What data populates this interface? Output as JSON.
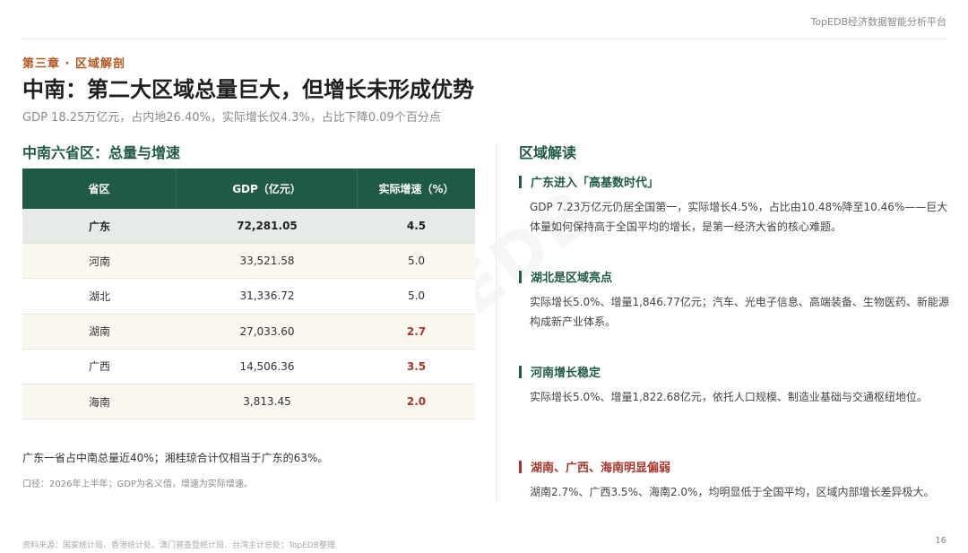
{
  "header": {
    "brand": "TopEDB经济数据智能分析平台"
  },
  "chapter": "第三章 · 区域解剖",
  "title": "中南：第二大区域总量巨大，但增长未形成优势",
  "subtitle": "GDP 18.25万亿元，占内地26.40%，实际增长仅4.3%，占比下降0.09个百分点",
  "watermark": "TopEDB",
  "left": {
    "title": "中南六省区：总量与增速",
    "columns": [
      "省区",
      "GDP（亿元）",
      "实际增速（%）"
    ],
    "rows": [
      [
        "广东",
        "72,281.05",
        "4.5"
      ],
      [
        "河南",
        "33,521.58",
        "5.0"
      ],
      [
        "湖北",
        "31,336.72",
        "5.0"
      ],
      [
        "湖南",
        "27,033.60",
        "2.7"
      ],
      [
        "广西",
        "14,506.36",
        "3.5"
      ],
      [
        "海南",
        "3,813.45",
        "2.0"
      ]
    ],
    "note": "广东一省占中南总量近40%；湘桂琼合计仅相当于广东的63%。",
    "caliber": "口径：2026年上半年；GDP为名义值，增速为实际增速。"
  },
  "right": {
    "title": "区域解读",
    "items": [
      {
        "title": "广东进入「高基数时代」",
        "body": "GDP 7.23万亿元仍居全国第一，实际增长4.5%，占比由10.48%降至10.46%——巨大体量如何保持高于全国平均的增长，是第一经济大省的核心难题。"
      },
      {
        "title": "湖北是区域亮点",
        "body": "实际增长5.0%、增量1,846.77亿元；汽车、光电子信息、高端装备、生物医药、新能源构成新产业体系。"
      },
      {
        "title": "河南增长稳定",
        "body": "实际增长5.0%、增量1,822.68亿元，依托人口规模、制造业基础与交通枢纽地位。"
      },
      {
        "title": "湖南、广西、海南明显偏弱",
        "body": "湖南2.7%、广西3.5%、海南2.0%，均明显低于全国平均，区域内部增长差异极大。"
      }
    ]
  },
  "footer": {
    "source": "资料来源：国家统计局、香港统计处、澳门普查暨统计局、台湾主计总处；TopEDB整理",
    "page": "16"
  },
  "colors": {
    "primary": "#1e5a45",
    "accent": "#b5561f",
    "warn": "#a8352b"
  }
}
